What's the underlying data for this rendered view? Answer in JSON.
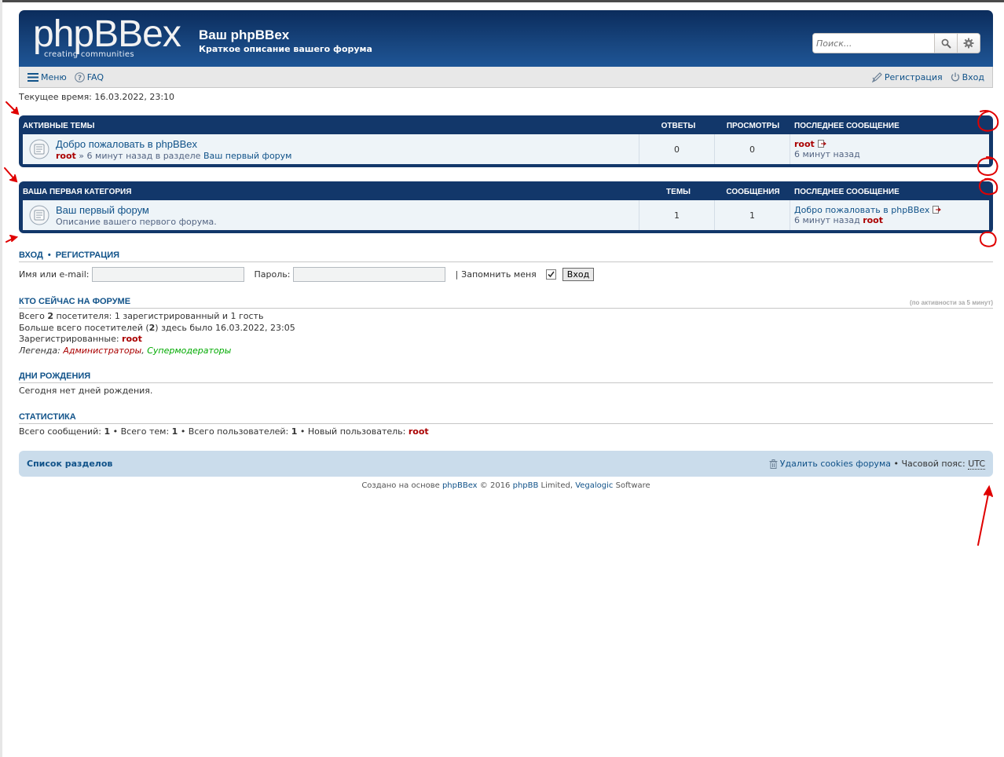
{
  "header": {
    "logo": "phpBBex",
    "logo_sub": "creating   communities",
    "site_title": "Ваш phpBBex",
    "site_desc": "Краткое описание вашего форума",
    "search_placeholder": "Поиск..."
  },
  "navbar": {
    "menu": "Меню",
    "faq": "FAQ",
    "register": "Регистрация",
    "login": "Вход"
  },
  "current_time": "Текущее время: 16.03.2022, 23:10",
  "active_topics": {
    "header": {
      "title": "АКТИВНЫЕ ТЕМЫ",
      "col1": "ОТВЕТЫ",
      "col2": "ПРОСМОТРЫ",
      "col3": "ПОСЛЕДНЕЕ СООБЩЕНИЕ"
    },
    "row": {
      "title": "Добро пожаловать в phpBBex",
      "author": "root",
      "sub_rest": " » 6 минут назад в разделе ",
      "sub_forum": "Ваш первый форум",
      "n1": "0",
      "n2": "0",
      "last_author": "root",
      "last_time": "6 минут назад"
    }
  },
  "category": {
    "header": {
      "title": "ВАША ПЕРВАЯ КАТЕГОРИЯ",
      "col1": "ТЕМЫ",
      "col2": "СООБЩЕНИЯ",
      "col3": "ПОСЛЕДНЕЕ СООБЩЕНИЕ"
    },
    "row": {
      "title": "Ваш первый форум",
      "desc": "Описание вашего первого форума.",
      "n1": "1",
      "n2": "1",
      "last_topic": "Добро пожаловать в phpBBex",
      "last_time": "6 минут назад ",
      "last_author": "root"
    }
  },
  "login": {
    "h_login": "ВХОД",
    "sep": "•",
    "h_register": "РЕГИСТРАЦИЯ",
    "user_label": "Имя или e-mail:",
    "pass_label": "Пароль:",
    "remember_sep": "|",
    "remember": "Запомнить меня",
    "button": "Вход"
  },
  "whois": {
    "title": "КТО СЕЙЧАС НА ФОРУМЕ",
    "note": "(по активности за 5 минут)",
    "l1_a": "Всего ",
    "l1_b": "2",
    "l1_c": " посетителя: 1 зарегистрированный и 1 гость",
    "l2_a": "Больше всего посетителей (",
    "l2_b": "2",
    "l2_c": ") здесь было 16.03.2022, 23:05",
    "l3_a": "Зарегистрированные: ",
    "l3_b": "root",
    "l4_a": "Легенда: ",
    "l4_admin": "Администраторы",
    "l4_comma": ", ",
    "l4_smod": "Супермодераторы"
  },
  "birthdays": {
    "title": "ДНИ РОЖДЕНИЯ",
    "text": "Сегодня нет дней рождения."
  },
  "stats": {
    "title": "СТАТИСТИКА",
    "a": "Всего сообщений: ",
    "a_v": "1",
    "b": " • Всего тем: ",
    "b_v": "1",
    "c": " • Всего пользователей: ",
    "c_v": "1",
    "d": " • Новый пользователь: ",
    "d_v": "root"
  },
  "footer": {
    "index": "Список разделов",
    "delete_cookies": "Удалить cookies форума",
    "tz_sep": " • ",
    "tz_label": "Часовой пояс: ",
    "tz": "UTC",
    "copy_a": "Создано на основе ",
    "copy_b": "phpBBex",
    "copy_c": " © 2016 ",
    "copy_d": "phpBB",
    "copy_e": " Limited, ",
    "copy_f": "Vegalogic",
    "copy_g": " Software"
  },
  "colors": {
    "header_dark": "#0b2c5c",
    "link": "#105289",
    "user_admin": "#aa0000",
    "row_bg": "#eef4f8",
    "annotation": "#e00000"
  }
}
